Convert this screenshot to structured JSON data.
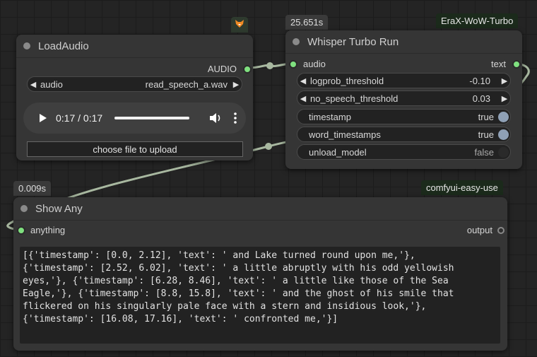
{
  "load_audio": {
    "title": "LoadAudio",
    "output_label": "AUDIO",
    "audio_widget": {
      "label": "audio",
      "value": "read_speech_a.wav"
    },
    "player": {
      "time": "0:17 / 0:17",
      "progress": 1.0
    },
    "upload_button": "choose file to upload",
    "badge_icon": "fox-icon"
  },
  "whisper": {
    "timing_badge": "25.651s",
    "pack_tag": "EraX-WoW-Turbo",
    "title": "Whisper Turbo Run",
    "input_label": "audio",
    "output_label": "text",
    "widgets": [
      {
        "label": "logprob_threshold",
        "value": "-0.10"
      },
      {
        "label": "no_speech_threshold",
        "value": "0.03"
      }
    ],
    "toggles": [
      {
        "label": "timestamp",
        "value": "true",
        "on": true
      },
      {
        "label": "word_timestamps",
        "value": "true",
        "on": true
      },
      {
        "label": "unload_model",
        "value": "false",
        "on": false
      }
    ]
  },
  "show_any": {
    "timing_badge": "0.009s",
    "pack_tag": "comfyui-easy-use",
    "title": "Show Any",
    "input_label": "anything",
    "output_label": "output",
    "text": "[{'timestamp': [0.0, 2.12], 'text': ' and Lake turned round upon me,'},\n{'timestamp': [2.52, 6.02], 'text': ' a little abruptly with his odd yellowish\neyes,'}, {'timestamp': [6.28, 8.46], 'text': ' a little like those of the Sea\nEagle,'}, {'timestamp': [8.8, 15.8], 'text': ' and the ghost of his smile that\nflickered on his singularly pale face with a stern and insidious look,'},\n{'timestamp': [16.08, 17.16], 'text': ' confronted me,'}]"
  },
  "colors": {
    "slot_connected": "#7fe07f",
    "toggle_on": "#8fa0b5",
    "toggle_off": "#2a2a2a",
    "pack_tag_bg": "#1b2a1b"
  }
}
